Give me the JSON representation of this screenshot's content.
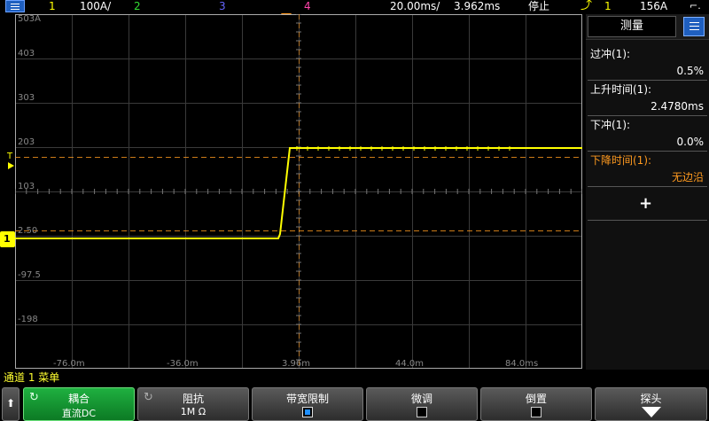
{
  "topbar": {
    "ch1_num": "1",
    "ch1_scale": "100A/",
    "ch2_num": "2",
    "ch3_num": "3",
    "ch4_num": "4",
    "timebase": "20.00ms/",
    "delay": "3.962ms",
    "run_state": "停止",
    "trigger_source": "1",
    "trigger_level": "156A"
  },
  "grid": {
    "y_labels": [
      "503A",
      "403",
      "303",
      "203",
      "103",
      "2.50",
      "-97.5",
      "-198"
    ],
    "x_labels": [
      "-76.0m",
      "-36.0m",
      "3.96m",
      "44.0m",
      "84.0ms"
    ],
    "trigger_marker": "T",
    "channel_marker": "1"
  },
  "panel": {
    "tab_label": "测量",
    "items": [
      {
        "label": "过冲(1):",
        "value": "0.5%"
      },
      {
        "label": "上升时间(1):",
        "value": "2.4780ms"
      },
      {
        "label": "下冲(1):",
        "value": "0.0%"
      },
      {
        "label": "下降时间(1):",
        "value": "无边沿"
      }
    ],
    "add_label": "+"
  },
  "channel_menu": "通道 1 菜单",
  "softkeys": {
    "back_arrow": "⬆",
    "coupling_title": "耦合",
    "coupling_value": "直流DC",
    "impedance_title": "阻抗",
    "impedance_value": "1M Ω",
    "bw_limit_title": "带宽限制",
    "fine_title": "微调",
    "invert_title": "倒置",
    "probe_title": "探头"
  },
  "colors": {
    "channel1": "#ffff00",
    "marker": "#ff9a1f",
    "accent": "#1f5fbf",
    "ch3": "#6666ff",
    "ch4": "#ff44aa",
    "ch2": "#33dd33"
  }
}
